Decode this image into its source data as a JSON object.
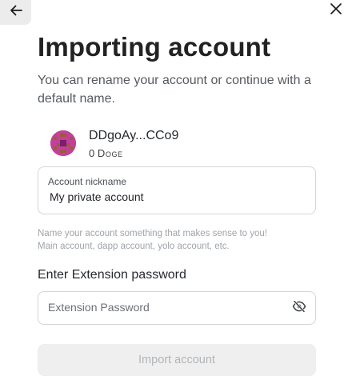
{
  "nav": {
    "back_icon": "arrow-left-icon",
    "close_icon": "close-icon"
  },
  "header": {
    "title": "Importing account",
    "subtitle": "You can rename your account or continue with a default name."
  },
  "account": {
    "avatar_icon": "identicon-avatar",
    "name": "DDgoAy...CCo9",
    "balance": "0",
    "balance_unit": "Doge"
  },
  "nickname": {
    "label": "Account nickname",
    "value": "My private account"
  },
  "hint": {
    "line1": "Name your account something that makes sense to you!",
    "line2": "Main account, dapp account, yolo account, etc."
  },
  "password": {
    "label": "Enter Extension password",
    "placeholder": "Extension Password",
    "toggle_icon": "eye-off-icon"
  },
  "actions": {
    "import_label": "Import account",
    "import_enabled": false
  },
  "colors": {
    "avatar_primary": "#c2409a",
    "avatar_secondary": "#7a1f6a",
    "avatar_accent": "#9e5a3a",
    "button_disabled_bg": "#efefef",
    "button_disabled_text": "#b2b5b9"
  }
}
